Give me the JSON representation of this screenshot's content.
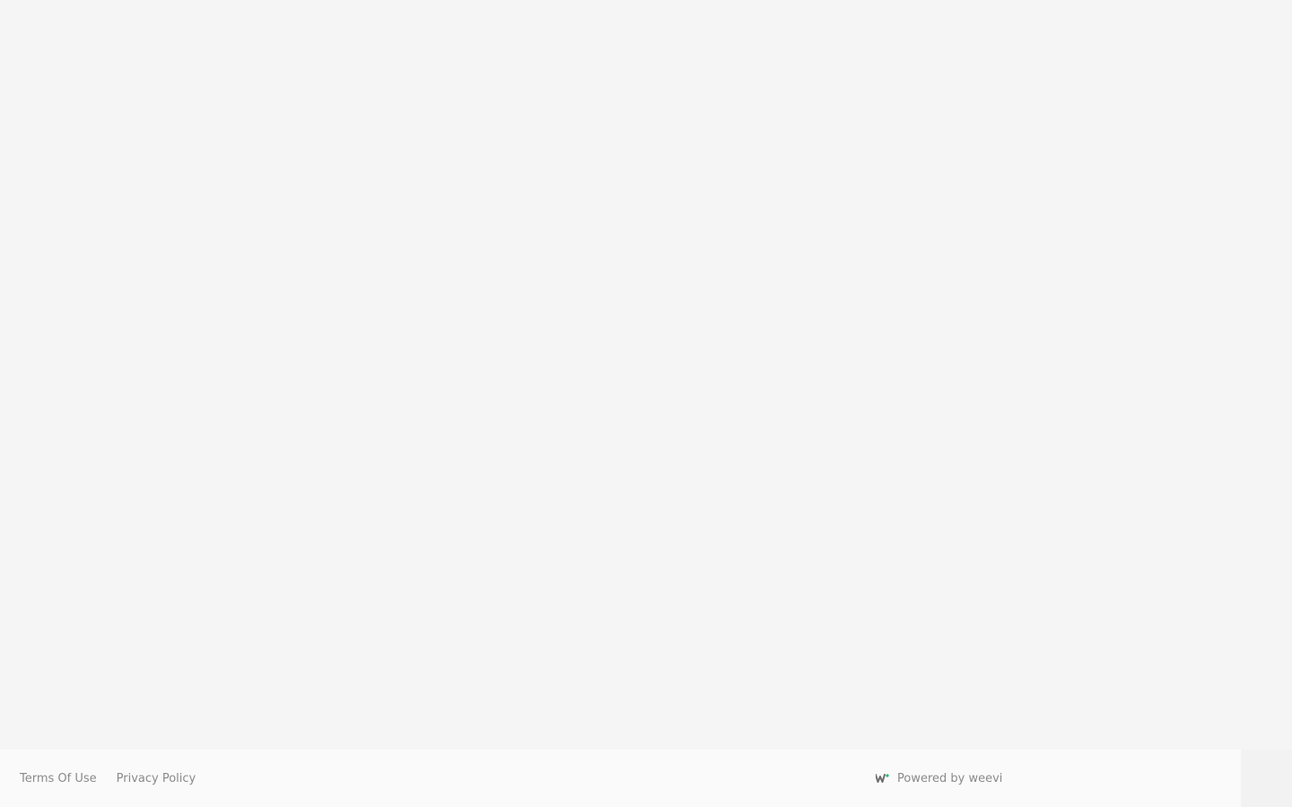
{
  "footer": {
    "links": [
      {
        "label": "Terms Of Use"
      },
      {
        "label": "Privacy Policy"
      }
    ],
    "powered_by": "Powered by weevi"
  },
  "logo": {
    "icon": "weevi-logo-icon",
    "colors": {
      "primary": "#6d6d6d",
      "accent": "#2bb673"
    }
  },
  "colors": {
    "background": "#f5f5f5",
    "footer_background": "#fafafa",
    "footer_text": "#8a8a8a"
  }
}
